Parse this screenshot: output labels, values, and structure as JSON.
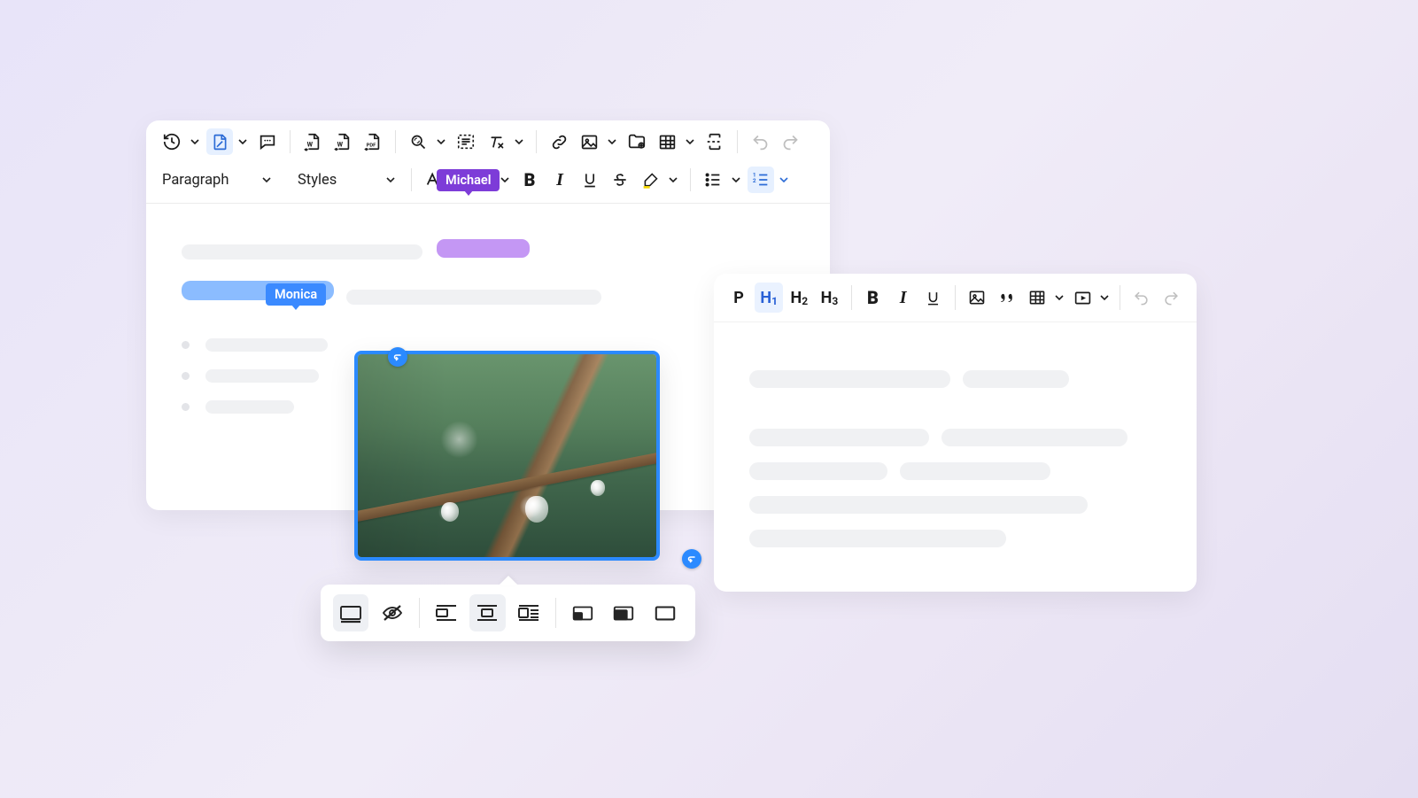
{
  "main_editor": {
    "row1_icons": [
      "history",
      "tracked-changes",
      "comment",
      "word-import",
      "word-export",
      "pdf-export",
      "find-replace",
      "source",
      "clear-formatting",
      "link",
      "image",
      "file-browser",
      "table",
      "page-break",
      "undo",
      "redo"
    ],
    "dropdowns": {
      "paragraph": "Paragraph",
      "styles": "Styles"
    },
    "row2_icons": [
      "font-size",
      "case",
      "bold",
      "italic",
      "underline",
      "strikethrough",
      "highlight",
      "bullet-list",
      "numbered-list"
    ],
    "collaborators": {
      "michael": "Michael",
      "monica": "Monica"
    }
  },
  "image_toolbar_icons": [
    "inline",
    "captioned",
    "align-left",
    "align-center",
    "wrap",
    "resize-small",
    "resize-medium",
    "original-size"
  ],
  "secondary_editor": {
    "formats": {
      "p": "P",
      "h1_main": "H",
      "h1_sub": "1",
      "h2_main": "H",
      "h2_sub": "2",
      "h3_main": "H",
      "h3_sub": "3"
    },
    "icons": [
      "bold",
      "italic",
      "underline",
      "image",
      "blockquote",
      "table",
      "media",
      "undo",
      "redo"
    ]
  }
}
